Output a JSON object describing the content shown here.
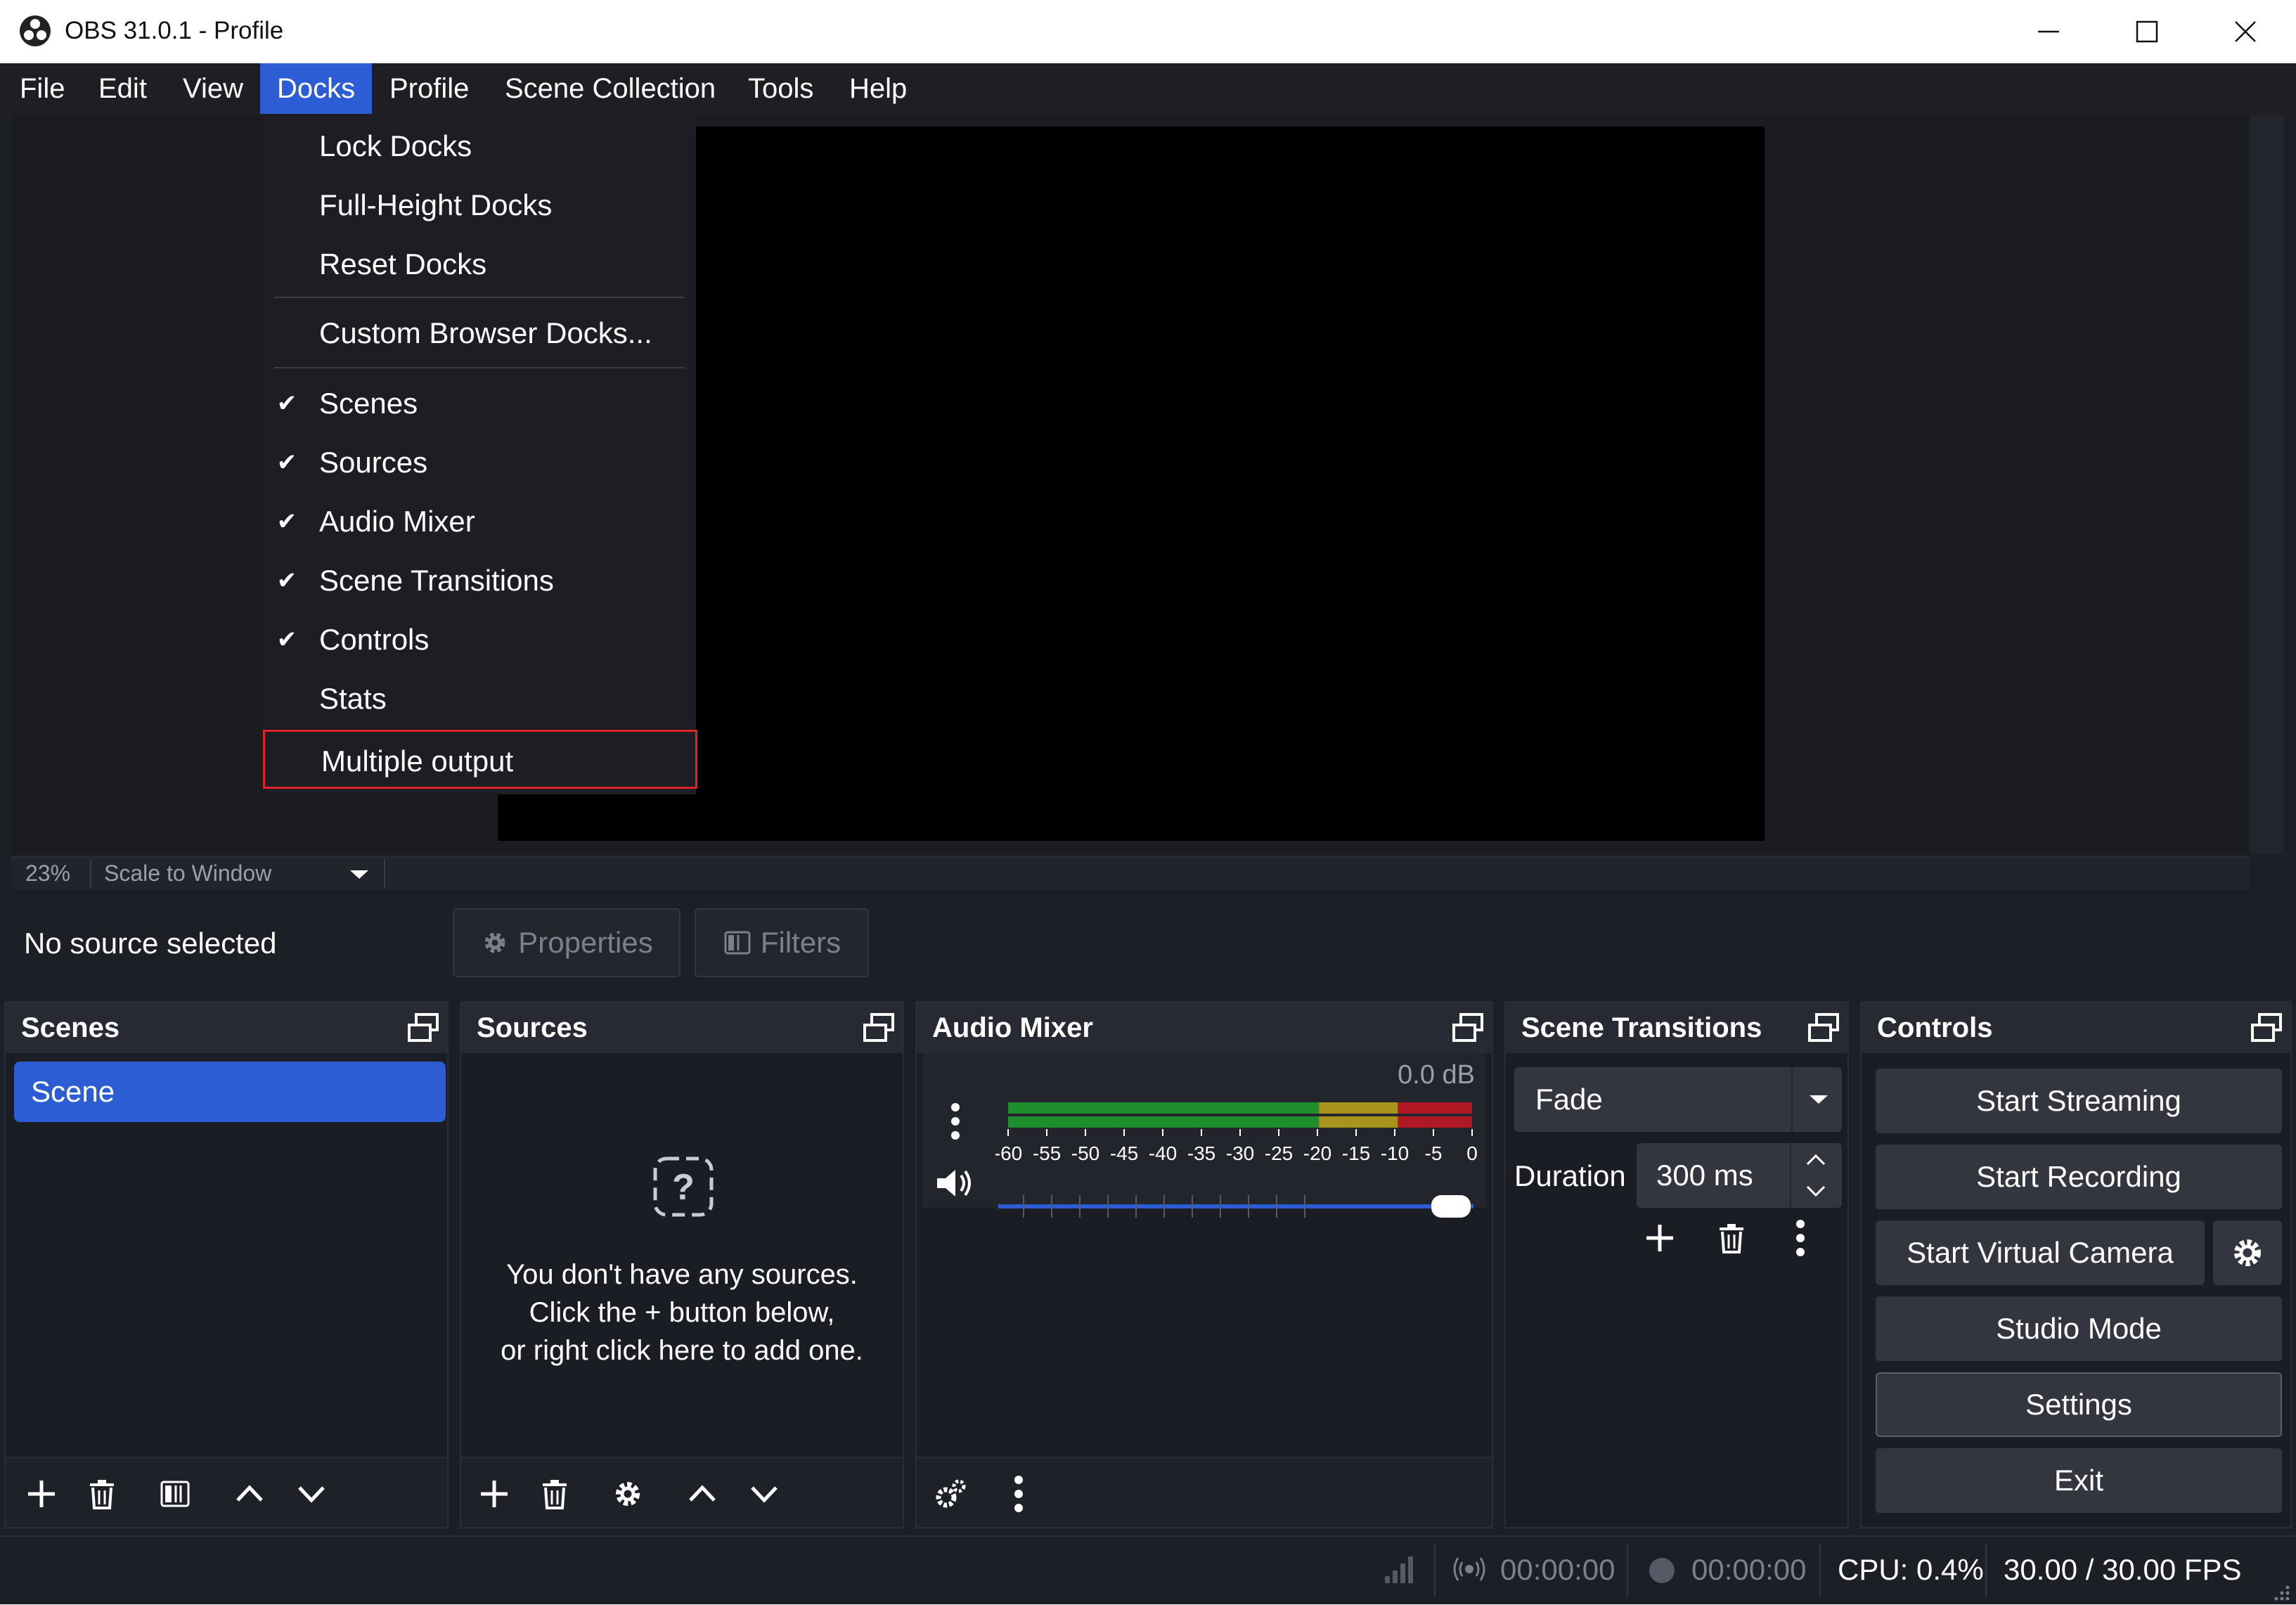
{
  "window": {
    "title": "OBS 31.0.1 - Profile",
    "controls": [
      "minimize-icon",
      "maximize-icon",
      "close-icon"
    ]
  },
  "menubar": {
    "items": [
      "File",
      "Edit",
      "View",
      "Docks",
      "Profile",
      "Scene Collection",
      "Tools",
      "Help"
    ],
    "active": "Docks"
  },
  "docks_menu": {
    "items": [
      {
        "label": "Lock Docks",
        "checked": false
      },
      {
        "label": "Full-Height Docks",
        "checked": false
      },
      {
        "label": "Reset Docks",
        "checked": false
      },
      {
        "label": "Custom Browser Docks...",
        "checked": false
      },
      {
        "label": "Scenes",
        "checked": true
      },
      {
        "label": "Sources",
        "checked": true
      },
      {
        "label": "Audio Mixer",
        "checked": true
      },
      {
        "label": "Scene Transitions",
        "checked": true
      },
      {
        "label": "Controls",
        "checked": true
      },
      {
        "label": "Stats",
        "checked": false
      },
      {
        "label": "Multiple output",
        "checked": false,
        "highlighted": true
      }
    ],
    "check_glyph": "✔"
  },
  "preview": {
    "zoom": "23%",
    "scale_mode": "Scale to Window"
  },
  "source_bar": {
    "status": "No source selected",
    "properties_label": "Properties",
    "filters_label": "Filters"
  },
  "scenes_dock": {
    "title": "Scenes",
    "items": [
      "Scene"
    ]
  },
  "sources_dock": {
    "title": "Sources",
    "empty_line1": "You don't have any sources.",
    "empty_line2": "Click the + button below,",
    "empty_line3": "or right click here to add one."
  },
  "audio_dock": {
    "title": "Audio Mixer",
    "level": "0.0 dB",
    "meter_ticks": [
      "-60",
      "-55",
      "-50",
      "-45",
      "-40",
      "-35",
      "-30",
      "-25",
      "-20",
      "-15",
      "-10",
      "-5",
      "0"
    ],
    "volume": 1.0
  },
  "transitions_dock": {
    "title": "Scene Transitions",
    "transition": "Fade",
    "duration_label": "Duration",
    "duration_value": "300 ms"
  },
  "controls_dock": {
    "title": "Controls",
    "start_streaming": "Start Streaming",
    "start_recording": "Start Recording",
    "start_virtual_camera": "Start Virtual Camera",
    "studio_mode": "Studio Mode",
    "settings": "Settings",
    "exit": "Exit"
  },
  "statusbar": {
    "stream_time": "00:00:00",
    "record_time": "00:00:00",
    "cpu": "CPU: 0.4%",
    "fps": "30.00 / 30.00 FPS"
  },
  "colors": {
    "accent": "#2d5dd4",
    "highlight_border": "#e0202a",
    "meter_green": "#1f9a2e",
    "meter_yellow": "#b8a11a",
    "meter_red": "#c01822"
  }
}
